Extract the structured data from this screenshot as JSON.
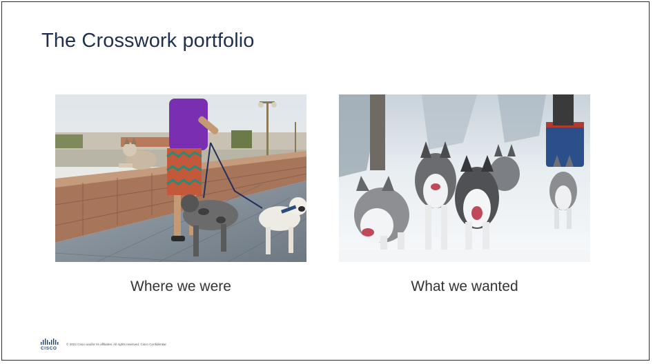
{
  "slide": {
    "title": "The Crosswork portfolio",
    "left_caption": "Where we were",
    "right_caption": "What we wanted",
    "footer_text": "© 2022 Cisco and/or its affiliates. All rights reserved.   Cisco Confidential",
    "logo_text": "CISCO"
  },
  "colors": {
    "title": "#1f2f4d",
    "caption": "#333333",
    "cisco_blue": "#1e4471"
  },
  "images": {
    "left": "dog-walker-photo",
    "right": "sled-dogs-photo"
  }
}
